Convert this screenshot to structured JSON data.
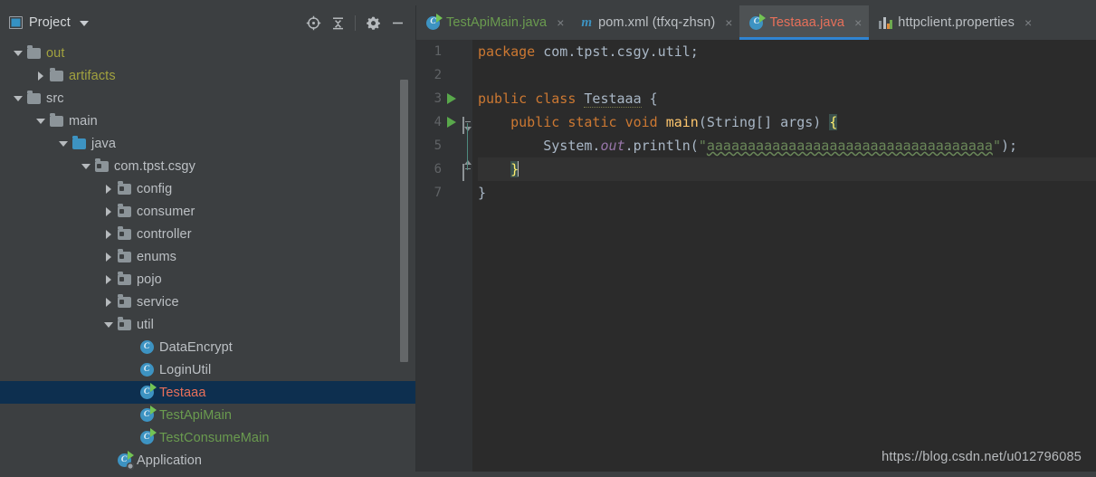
{
  "panel": {
    "title": "Project",
    "icon": "project-window-icon",
    "dropdown_icon": "chevron-down-icon",
    "tools": [
      {
        "name": "locate-icon",
        "label": "Select Opened File"
      },
      {
        "name": "collapse-all-icon",
        "label": "Collapse All"
      },
      {
        "name": "gear-icon",
        "label": "Settings"
      },
      {
        "name": "minimize-icon",
        "label": "Hide"
      }
    ]
  },
  "tree": {
    "items": [
      {
        "label": "out",
        "depth": 0,
        "twisty": "open",
        "icon": "folder",
        "color": "#a2a23f",
        "selected": false
      },
      {
        "label": "artifacts",
        "depth": 1,
        "twisty": "closed",
        "icon": "folder",
        "color": "#a2a23f",
        "selected": false
      },
      {
        "label": "src",
        "depth": 0,
        "twisty": "open",
        "icon": "folder",
        "color": "#bcc0c4",
        "selected": false
      },
      {
        "label": "main",
        "depth": 1,
        "twisty": "open",
        "icon": "folder",
        "color": "#bcc0c4",
        "selected": false
      },
      {
        "label": "java",
        "depth": 2,
        "twisty": "open",
        "icon": "folder-blue",
        "color": "#bcc0c4",
        "selected": false
      },
      {
        "label": "com.tpst.csgy",
        "depth": 3,
        "twisty": "open",
        "icon": "package",
        "color": "#bcc0c4",
        "selected": false
      },
      {
        "label": "config",
        "depth": 4,
        "twisty": "closed",
        "icon": "package",
        "color": "#bcc0c4",
        "selected": false
      },
      {
        "label": "consumer",
        "depth": 4,
        "twisty": "closed",
        "icon": "package",
        "color": "#bcc0c4",
        "selected": false
      },
      {
        "label": "controller",
        "depth": 4,
        "twisty": "closed",
        "icon": "package",
        "color": "#bcc0c4",
        "selected": false
      },
      {
        "label": "enums",
        "depth": 4,
        "twisty": "closed",
        "icon": "package",
        "color": "#bcc0c4",
        "selected": false
      },
      {
        "label": "pojo",
        "depth": 4,
        "twisty": "closed",
        "icon": "package",
        "color": "#bcc0c4",
        "selected": false
      },
      {
        "label": "service",
        "depth": 4,
        "twisty": "closed",
        "icon": "package",
        "color": "#bcc0c4",
        "selected": false
      },
      {
        "label": "util",
        "depth": 4,
        "twisty": "open",
        "icon": "package",
        "color": "#bcc0c4",
        "selected": false
      },
      {
        "label": "DataEncrypt",
        "depth": 5,
        "twisty": "none",
        "icon": "class",
        "color": "#bcc0c4",
        "selected": false
      },
      {
        "label": "LoginUtil",
        "depth": 5,
        "twisty": "none",
        "icon": "class",
        "color": "#bcc0c4",
        "selected": false
      },
      {
        "label": "Testaaa",
        "depth": 5,
        "twisty": "none",
        "icon": "class-runnable",
        "color": "#e8705a",
        "selected": true
      },
      {
        "label": "TestApiMain",
        "depth": 5,
        "twisty": "none",
        "icon": "class-runnable",
        "color": "#6a9b4f",
        "selected": false
      },
      {
        "label": "TestConsumeMain",
        "depth": 5,
        "twisty": "none",
        "icon": "class-runnable",
        "color": "#6a9b4f",
        "selected": false
      },
      {
        "label": "Application",
        "depth": 4,
        "twisty": "none",
        "icon": "class-application",
        "color": "#bcc0c4",
        "selected": false
      }
    ],
    "selected_color": "#0d2f4f"
  },
  "tabs": [
    {
      "label": "TestApiMain.java",
      "icon": "java-class-runnable-icon",
      "color": "#6a9b4f",
      "active": false,
      "close": "×"
    },
    {
      "label": "pom.xml (tfxq-zhsn)",
      "icon": "maven-icon",
      "color": "#bcc0c4",
      "active": false,
      "close": "×"
    },
    {
      "label": "Testaaa.java",
      "icon": "java-class-runnable-icon",
      "color": "#e8705a",
      "active": true,
      "close": "×"
    },
    {
      "label": "httpclient.properties",
      "icon": "properties-file-icon",
      "color": "#bcc0c4",
      "active": false,
      "close": "×"
    }
  ],
  "editor": {
    "filename": "Testaaa.java",
    "lines": [
      {
        "no": "1",
        "run": false,
        "fold": "none"
      },
      {
        "no": "2",
        "run": false,
        "fold": "none"
      },
      {
        "no": "3",
        "run": true,
        "fold": "none"
      },
      {
        "no": "4",
        "run": true,
        "fold": "down"
      },
      {
        "no": "5",
        "run": false,
        "fold": "none"
      },
      {
        "no": "6",
        "run": false,
        "fold": "up"
      },
      {
        "no": "7",
        "run": false,
        "fold": "none"
      }
    ],
    "code": {
      "l1_kw_package": "package",
      "l1_pkg": " com.tpst.csgy.util;",
      "l3_kw_public": "public",
      "l3_kw_class": "class",
      "l3_name": "Testaaa",
      "l3_brace": "{",
      "l4_kw_public": "public",
      "l4_kw_static": "static",
      "l4_kw_void": "void",
      "l4_method": "main",
      "l4_params": "(String[] args) ",
      "l4_brace": "{",
      "l5_system": "System.",
      "l5_out": "out",
      "l5_println": ".println(",
      "l5_quote_open": "\"",
      "l5_string": "aaaaaaaaaaaaaaaaaaaaaaaaaaaaaaaaaaa",
      "l5_quote_close": "\"",
      "l5_tail": ");",
      "l6_brace": "}",
      "l7_brace": "}"
    },
    "caret_line": 6
  },
  "watermark": "https://blog.csdn.net/u012796085",
  "theme": {
    "bg_panel": "#3c3f41",
    "bg_editor": "#2b2b2b",
    "bg_gutter": "#313335",
    "accent_tab": "#2f84d2",
    "keyword": "#cc7832",
    "string": "#6a8759",
    "method": "#ffc66d",
    "static_field": "#9876aa",
    "text": "#a9b7c6"
  }
}
